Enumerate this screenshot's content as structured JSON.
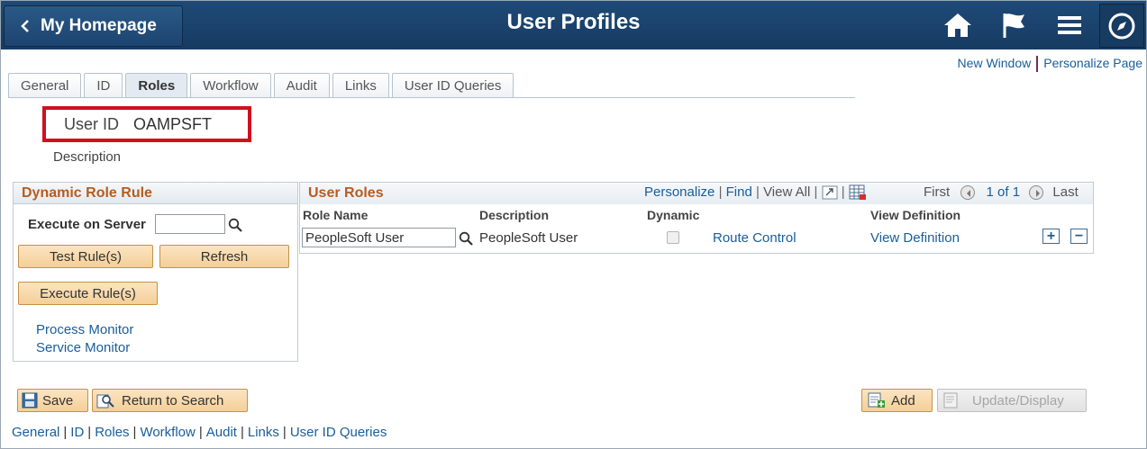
{
  "header": {
    "back_label": "My Homepage",
    "title": "User Profiles",
    "icons": [
      "home-icon",
      "flag-icon",
      "menu-icon",
      "navbar-compass-icon"
    ]
  },
  "top_links": {
    "new_window": "New Window",
    "personalize_page": "Personalize Page"
  },
  "tabs": [
    {
      "label": "General",
      "active": false
    },
    {
      "label": "ID",
      "active": false
    },
    {
      "label": "Roles",
      "active": true
    },
    {
      "label": "Workflow",
      "active": false
    },
    {
      "label": "Audit",
      "active": false
    },
    {
      "label": "Links",
      "active": false
    },
    {
      "label": "User ID Queries",
      "active": false
    }
  ],
  "user": {
    "id_label": "User ID",
    "id_value": "OAMPSFT",
    "description_label": "Description"
  },
  "dynamic_role": {
    "title": "Dynamic Role Rule",
    "execute_on_server_label": "Execute on Server",
    "execute_on_server_value": "",
    "test_rules": "Test Rule(s)",
    "refresh": "Refresh",
    "execute_rules": "Execute Rule(s)",
    "process_monitor": "Process Monitor",
    "service_monitor": "Service Monitor"
  },
  "user_roles": {
    "title": "User Roles",
    "personalize": "Personalize",
    "find": "Find",
    "view_all": "View All",
    "first": "First",
    "range": "1 of 1",
    "last": "Last",
    "columns": {
      "role_name": "Role Name",
      "description": "Description",
      "dynamic": "Dynamic",
      "view_definition": "View Definition"
    },
    "rows": [
      {
        "role_name": "PeopleSoft User",
        "description": "PeopleSoft User",
        "dynamic": false,
        "route_control": "Route Control",
        "view_definition": "View Definition"
      }
    ]
  },
  "footer_buttons": {
    "save": "Save",
    "return_to_search": "Return to Search",
    "add": "Add",
    "update_display": "Update/Display"
  },
  "bottom_links": [
    "General",
    "ID",
    "Roles",
    "Workflow",
    "Audit",
    "Links",
    "User ID Queries"
  ],
  "colors": {
    "banner": "#1f4a77",
    "highlight_border": "#d10f1f",
    "section_title": "#b85c1e",
    "link": "#1a5d9a"
  }
}
